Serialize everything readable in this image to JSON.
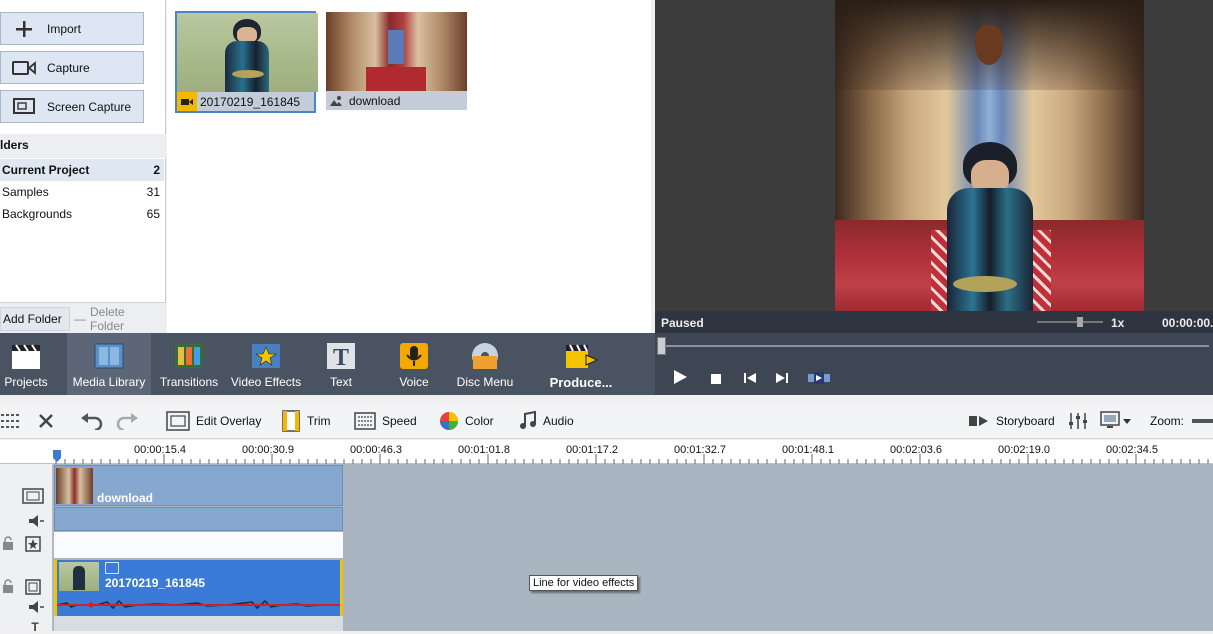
{
  "left_panel": {
    "buttons": [
      {
        "label": "Import",
        "icon": "plus-icon"
      },
      {
        "label": "Capture",
        "icon": "video-camera-icon"
      },
      {
        "label": "Screen Capture",
        "icon": "screen-capture-icon"
      }
    ],
    "folders_header": "lders",
    "folders": [
      {
        "name": "Current Project",
        "count": "2"
      },
      {
        "name": "Samples",
        "count": "31"
      },
      {
        "name": "Backgrounds",
        "count": "65"
      }
    ],
    "add_folder": "Add Folder",
    "delete_folder": "Delete Folder"
  },
  "media": {
    "items": [
      {
        "name": "20170219_161845",
        "type": "video-icon"
      },
      {
        "name": "download",
        "type": "image-icon"
      }
    ]
  },
  "preview": {
    "status": "Paused",
    "speed": "1x",
    "time": "00:00:00."
  },
  "main_toolbar": {
    "items": [
      {
        "label": "Projects",
        "icon": "clapperboard-icon"
      },
      {
        "label": "Media Library",
        "icon": "film-strip-icon"
      },
      {
        "label": "Transitions",
        "icon": "transitions-icon"
      },
      {
        "label": "Video Effects",
        "icon": "star-effects-icon"
      },
      {
        "label": "Text",
        "icon": "text-icon"
      },
      {
        "label": "Voice",
        "icon": "microphone-icon"
      },
      {
        "label": "Disc Menu",
        "icon": "disc-icon"
      },
      {
        "label": "Produce...",
        "icon": "produce-icon"
      }
    ]
  },
  "edit_toolbar": {
    "edit_overlay": "Edit Overlay",
    "trim": "Trim",
    "speed": "Speed",
    "color": "Color",
    "audio": "Audio",
    "storyboard": "Storyboard",
    "zoom": "Zoom:"
  },
  "timeline": {
    "ticks": [
      "00:00:15.4",
      "00:00:30.9",
      "00:00:46.3",
      "00:01:01.8",
      "00:01:17.2",
      "00:01:32.7",
      "00:01:48.1",
      "00:02:03.6",
      "00:02:19.0",
      "00:02:34.5"
    ],
    "clip_image": "download",
    "clip_video": "20170219_161845",
    "tooltip": "Line for video effects"
  },
  "colors": {
    "toolbar_bg": "#4a5361",
    "accent_blue": "#3b7bd8",
    "clip_blue": "#86a7d0",
    "track_bg": "#a9b5c0"
  }
}
